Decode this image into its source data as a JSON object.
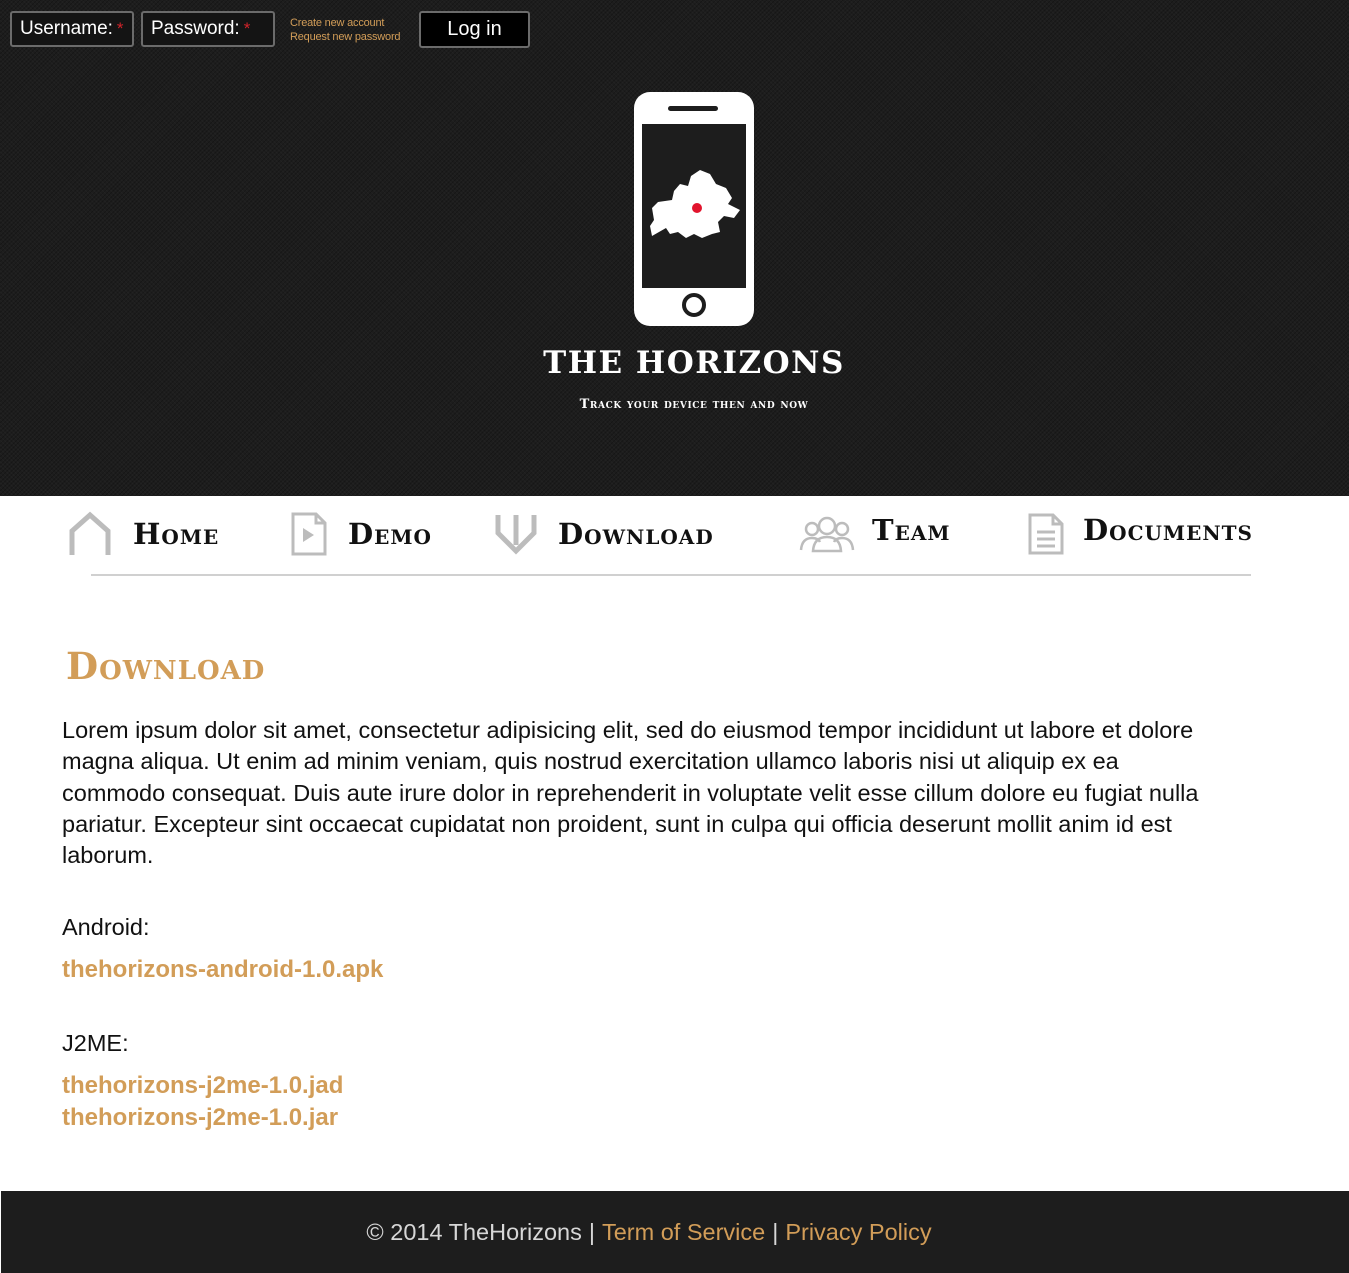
{
  "login": {
    "username_label": "Username:",
    "password_label": "Password:",
    "required_mark": "*",
    "create_account": "Create new account",
    "request_password": "Request new password",
    "login_button": "Log in"
  },
  "header": {
    "title": "THE HORIZONS",
    "tagline": "Track your device then and now"
  },
  "nav": {
    "items": [
      {
        "label": "Home",
        "icon": "home-icon"
      },
      {
        "label": "Demo",
        "icon": "play-document-icon"
      },
      {
        "label": "Download",
        "icon": "down-arrow-icon"
      },
      {
        "label": "Team",
        "icon": "team-icon"
      },
      {
        "label": "Documents",
        "icon": "document-icon"
      }
    ]
  },
  "main": {
    "title": "Download",
    "intro": "Lorem ipsum dolor sit amet, consectetur adipisicing elit, sed do eiusmod tempor incididunt ut labore et dolore magna aliqua. Ut enim ad minim veniam, quis nostrud exercitation ullamco laboris nisi ut aliquip ex ea commodo consequat. Duis aute irure dolor in reprehenderit in voluptate velit esse cillum dolore eu fugiat nulla pariatur. Excepteur sint occaecat cupidatat non proident, sunt in culpa qui officia deserunt mollit anim id est laborum.",
    "android_label": "Android:",
    "android_apk": "thehorizons-android-1.0.apk",
    "j2me_label": "J2ME:",
    "j2me_jad": "thehorizons-j2me-1.0.jad",
    "j2me_jar": "thehorizons-j2me-1.0.jar"
  },
  "footer": {
    "copyright": "© 2014 TheHorizons",
    "separator": "|",
    "terms": "Term of Service",
    "privacy": "Privacy Policy"
  },
  "colors": {
    "accent": "#d29d58",
    "header_bg": "#1d1d1d",
    "required": "#d2232a",
    "map_marker": "#e2142d"
  }
}
